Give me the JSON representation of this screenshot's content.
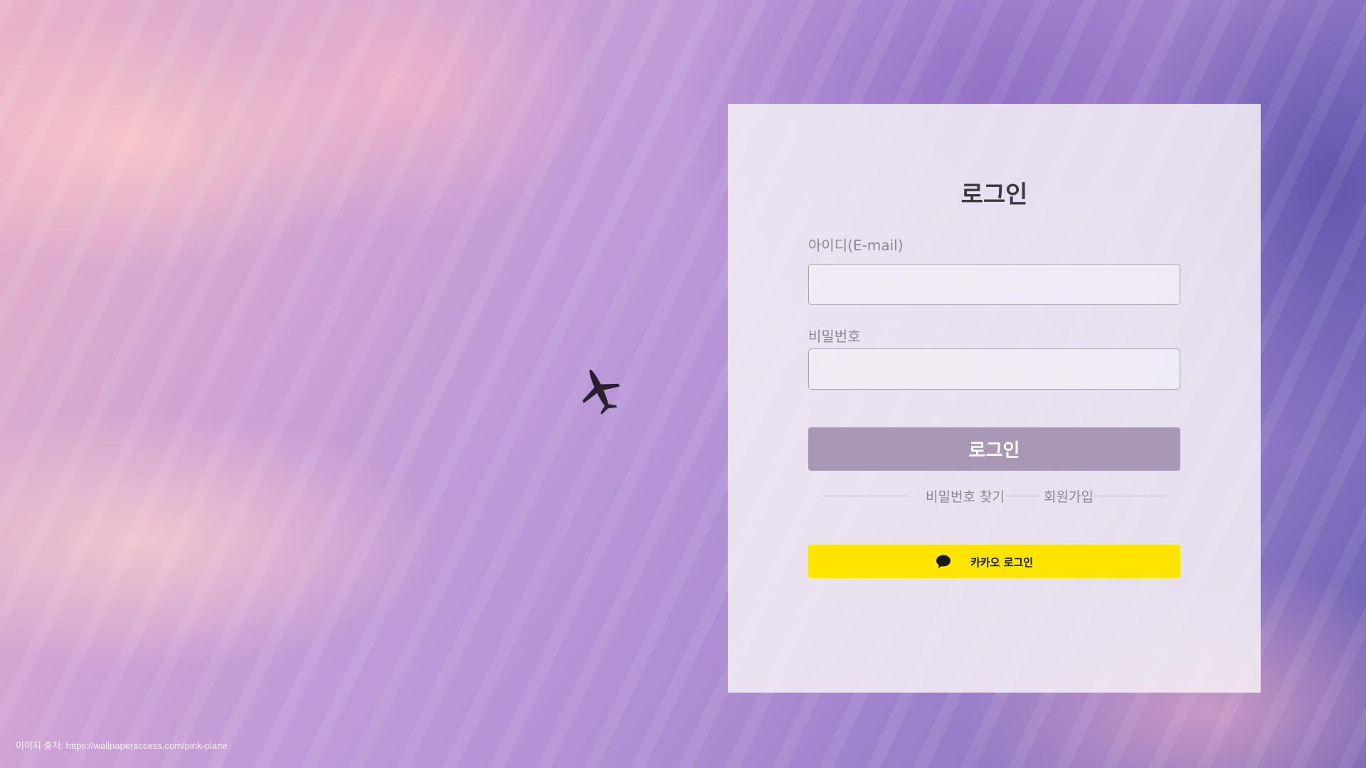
{
  "background": {
    "credit": "이미지 출처: https://wallpaperaccess.com/pink-plane"
  },
  "login_card": {
    "title": "로그인",
    "id_label": "아이디(E-mail)",
    "id_value": "",
    "password_label": "비밀번호",
    "password_value": "",
    "login_button": "로그인",
    "find_password_link": "비밀번호 찾기",
    "signup_link": "회원가입",
    "kakao_button": "카카오 로그인",
    "kakao_icon": "speech-bubble-icon"
  },
  "colors": {
    "login_button_bg": "#a898b5",
    "kakao_yellow": "#fee500",
    "title_text": "#3d3a3d",
    "label_text": "#8d8790"
  }
}
